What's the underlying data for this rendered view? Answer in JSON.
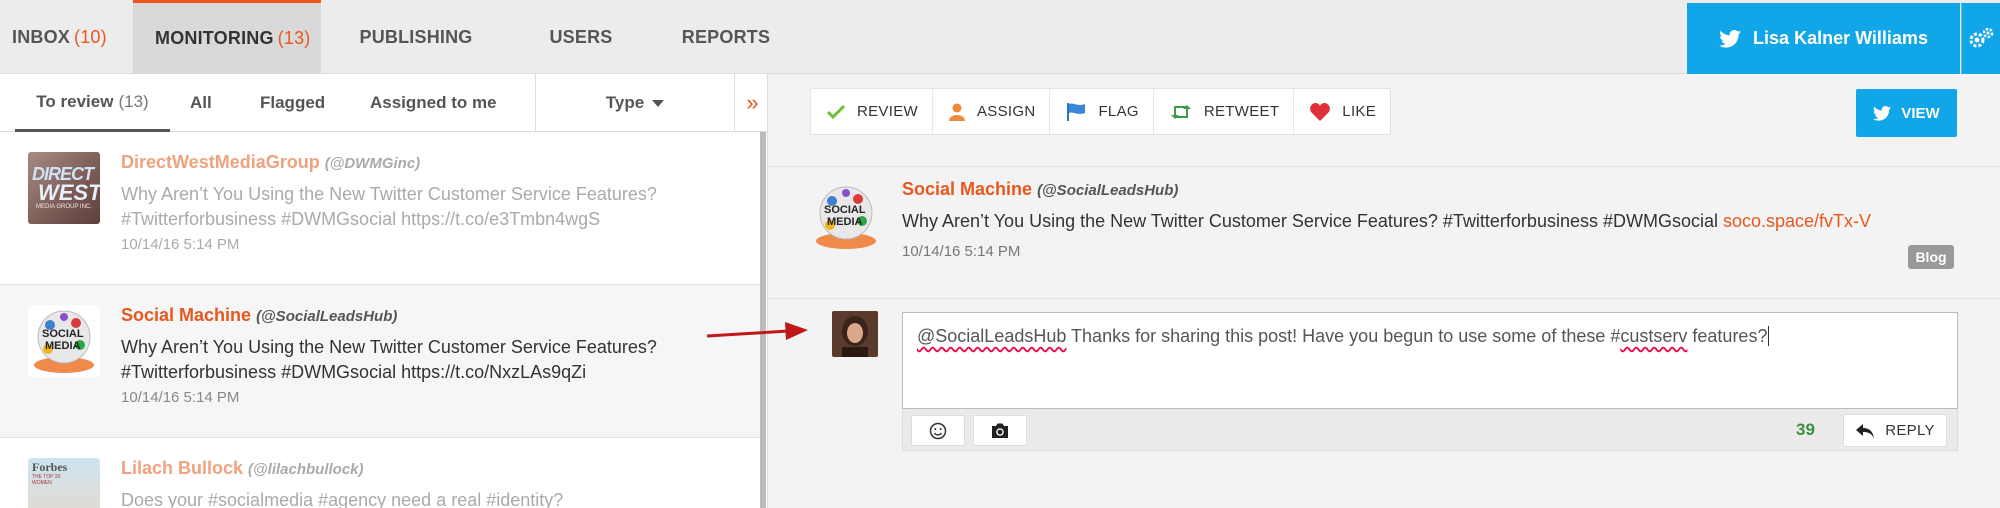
{
  "nav": {
    "tabs": [
      {
        "label": "INBOX",
        "count": "(10)"
      },
      {
        "label": "MONITORING",
        "count": "(13)"
      },
      {
        "label": "PUBLISHING"
      },
      {
        "label": "USERS"
      },
      {
        "label": "REPORTS"
      }
    ],
    "user_name": "Lisa Kalner Williams"
  },
  "subtabs": {
    "to_review": {
      "label": "To review",
      "count": "(13)"
    },
    "all": "All",
    "flagged": "Flagged",
    "assigned": "Assigned to me",
    "type": "Type",
    "collapse": "»"
  },
  "feed": [
    {
      "name": "DirectWestMediaGroup",
      "handle": "(@DWMGinc)",
      "text_line1": "Why Aren’t You Using the New Twitter Customer Service Features?",
      "text_line2": "#Twitterforbusiness #DWMGsocial https://t.co/e3Tmbn4wgS",
      "time": "10/14/16 5:14 PM",
      "avatar_text_1": "DIRECT",
      "avatar_text_2": "WEST",
      "avatar_text_3": "MEDIA GROUP INC."
    },
    {
      "name": "Social Machine",
      "handle": "(@SocialLeadsHub)",
      "text_line1": "Why Aren’t You Using the New Twitter Customer Service Features?",
      "text_line2": "#Twitterforbusiness #DWMGsocial https://t.co/NxzLAs9qZi",
      "time": "10/14/16 5:14 PM",
      "avatar_text_1": "SOCIAL",
      "avatar_text_2": "MEDIA"
    },
    {
      "name": "Lilach Bullock",
      "handle": "(@lilachbullock)",
      "text_line1": "Does your #socialmedia #agency need a real #identity?",
      "avatar_text_1": "Forbes",
      "avatar_text_2": "THE TOP 20",
      "avatar_text_3": "WOMEN"
    }
  ],
  "toolbar": {
    "review": "REVIEW",
    "assign": "ASSIGN",
    "flag": "FLAG",
    "retweet": "RETWEET",
    "like": "LIKE",
    "view": "VIEW"
  },
  "post": {
    "name": "Social Machine",
    "handle": "(@SocialLeadsHub)",
    "text": "Why Aren’t You Using the New Twitter Customer Service Features? #Twitterforbusiness #DWMGsocial ",
    "link": "soco.space/fvTx-V",
    "time": "10/14/16 5:14 PM",
    "badge": "Blog",
    "avatar_text_1": "SOCIAL",
    "avatar_text_2": "MEDIA"
  },
  "reply": {
    "mention": "@SocialLeadsHub",
    "text_mid": " Thanks for sharing this post! Have you begun to use some of these #",
    "hashtag": "custserv",
    "text_end": " features?",
    "char_count": "39",
    "reply_label": "REPLY"
  },
  "colors": {
    "accent": "#e8571e",
    "twitter_blue": "#11a6e8",
    "count_green": "#3d8f3d"
  }
}
